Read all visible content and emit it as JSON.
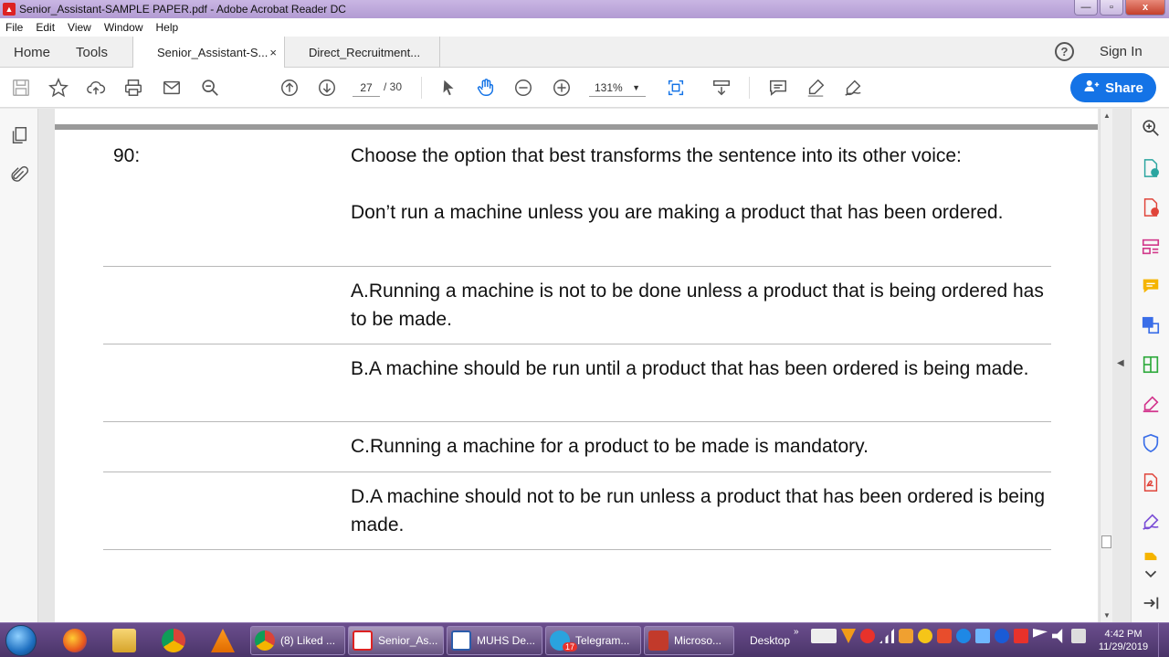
{
  "window": {
    "title": "Senior_Assistant-SAMPLE PAPER.pdf - Adobe Acrobat Reader DC",
    "minimize": "—",
    "maximize": "▫",
    "close": "x"
  },
  "menu": [
    "File",
    "Edit",
    "View",
    "Window",
    "Help"
  ],
  "tabs": {
    "home": "Home",
    "tools": "Tools",
    "doc1": "Senior_Assistant-S...",
    "doc1_close": "×",
    "doc2": "Direct_Recruitment...",
    "help": "?",
    "signin": "Sign In"
  },
  "toolbar": {
    "page_current": "27",
    "page_total": "/ 30",
    "zoom": "131%",
    "share": "Share",
    "accent": "#1473e6"
  },
  "question": {
    "number": "90:",
    "prompt": "Choose the option that best transforms the sentence into its other voice:",
    "sentence": "Don’t run a machine unless you are making a product that has been ordered.",
    "options": [
      "A.Running a machine is not to be done unless a product that is being ordered has to be made.",
      "B.A machine should be run until a product that has been ordered is being made.",
      "C.Running a machine for a product to be made is mandatory.",
      "D.A machine should not to be run unless a product that has been ordered is being made."
    ]
  },
  "taskbar": {
    "tasks": [
      "(8) Liked ...",
      "Senior_As...",
      "MUHS De...",
      "Telegram...",
      "Microso..."
    ],
    "telegram_badge": "17",
    "desktop": "Desktop",
    "chevron": "»",
    "time": "4:42 PM",
    "date": "11/29/2019"
  }
}
